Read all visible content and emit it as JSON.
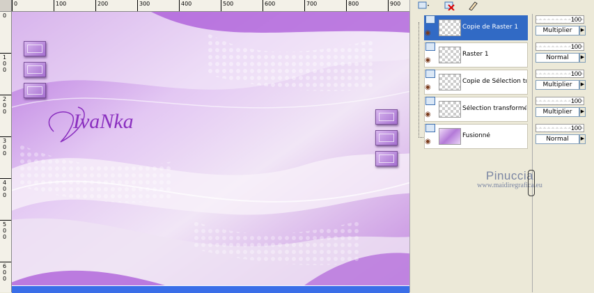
{
  "ruler": {
    "top_labels": [
      "0",
      "100",
      "200",
      "300",
      "400",
      "500",
      "600",
      "700",
      "800",
      "900"
    ],
    "left_labels": [
      "0",
      "100",
      "200",
      "300",
      "400",
      "500",
      "600"
    ]
  },
  "canvas": {
    "signature_text": "IvaNka",
    "colors": {
      "purple": "#a554d6",
      "lavender": "#e9d3f6",
      "light": "#f4eef7"
    }
  },
  "layers_toolbar": {
    "icons": [
      "new-layer-icon",
      "delete-layer-icon",
      "edit-icon"
    ]
  },
  "layers": [
    {
      "name": "Copie de Raster 1",
      "opacity": "100",
      "blend": "Multiplier",
      "selected": true,
      "thumb": "transparent"
    },
    {
      "name": "Raster 1",
      "opacity": "100",
      "blend": "Normal",
      "selected": false,
      "thumb": "transparent"
    },
    {
      "name": "Copie de Sélection tran",
      "opacity": "100",
      "blend": "Multiplier",
      "selected": false,
      "thumb": "transparent"
    },
    {
      "name": "Sélection transformée",
      "opacity": "100",
      "blend": "Multiplier",
      "selected": false,
      "thumb": "transparent"
    },
    {
      "name": "Fusionné",
      "opacity": "100",
      "blend": "Normal",
      "selected": false,
      "thumb": "merged"
    }
  ],
  "watermark": {
    "name": "Pinuccia",
    "url": "www.maidiregrafica.eu"
  }
}
